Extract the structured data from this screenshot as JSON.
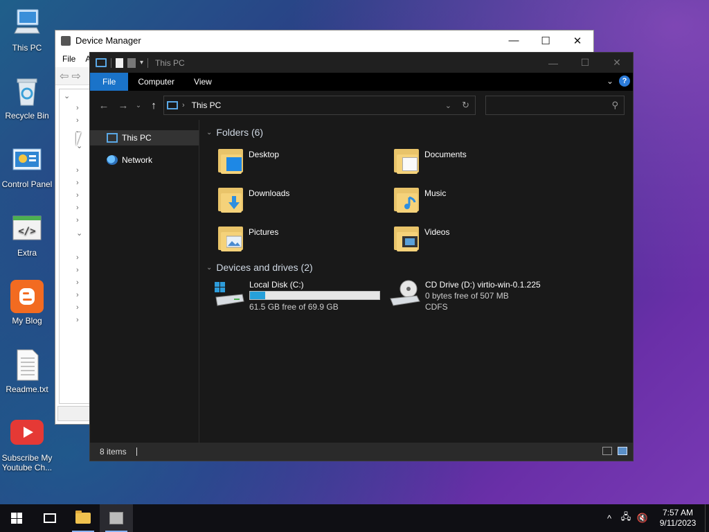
{
  "desktop": {
    "icons": [
      {
        "label": "This PC"
      },
      {
        "label": "Recycle Bin"
      },
      {
        "label": "Control Panel"
      },
      {
        "label": "Extra"
      },
      {
        "label": "My Blog"
      },
      {
        "label": "Readme.txt"
      },
      {
        "label": "Subscribe My Youtube Ch..."
      }
    ]
  },
  "device_manager": {
    "title": "Device Manager",
    "menu": {
      "file": "File",
      "action": "A"
    },
    "controls": {
      "minimize": "—",
      "maximize": "☐",
      "close": "✕"
    }
  },
  "explorer": {
    "title": "This PC",
    "controls": {
      "minimize": "—",
      "maximize": "☐",
      "close": "✕"
    },
    "ribbon_tabs": {
      "file": "File",
      "computer": "Computer",
      "view": "View"
    },
    "help_label": "?",
    "address": {
      "location": "This PC",
      "separator": "›"
    },
    "search": {
      "placeholder": ""
    },
    "sidebar": {
      "items": [
        {
          "label": "This PC",
          "selected": true
        },
        {
          "label": "Network",
          "selected": false
        }
      ]
    },
    "folders": {
      "header": "Folders (6)",
      "items": [
        {
          "name": "Desktop"
        },
        {
          "name": "Documents"
        },
        {
          "name": "Downloads"
        },
        {
          "name": "Music"
        },
        {
          "name": "Pictures"
        },
        {
          "name": "Videos"
        }
      ]
    },
    "drives": {
      "header": "Devices and drives (2)",
      "items": [
        {
          "name": "Local Disk (C:)",
          "space": "61.5 GB free of 69.9 GB",
          "used_fraction": 0.12
        },
        {
          "name": "CD Drive (D:) virtio-win-0.1.225",
          "space": "0 bytes free of 507 MB",
          "fs": "CDFS"
        }
      ]
    },
    "status": {
      "count": "8 items"
    }
  },
  "taskbar": {
    "clock": {
      "time": "7:57 AM",
      "date": "9/11/2023"
    },
    "tray": {
      "chevron": "^"
    }
  },
  "colors": {
    "accent": "#1a73c9",
    "bar_fill": "#26a0da"
  }
}
